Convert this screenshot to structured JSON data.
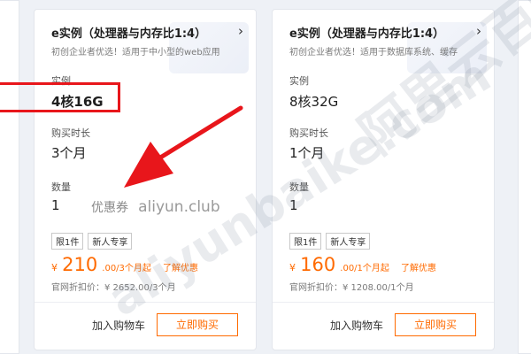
{
  "cards": [
    {
      "title": "e实例（处理器与内存比1:4）",
      "desc": "初创企业者优选！适用于中小型的web应用",
      "instance_label": "实例",
      "instance_value": "4核16G",
      "duration_label": "购买时长",
      "duration_value": "3个月",
      "qty_label": "数量",
      "qty_value": "1",
      "tags": [
        "限1件",
        "新人专享"
      ],
      "price_prefix": "¥",
      "price_main": "210",
      "price_suffix": ".00/3个月起",
      "promo_link": "了解优惠",
      "original_price": "官网折扣价：¥ 2652.00/3个月",
      "cart_label": "加入购物车",
      "buy_label": "立即购买"
    },
    {
      "title": "e实例（处理器与内存比1:4）",
      "desc": "初创企业者优选！适用于数据库系统、缓存",
      "instance_label": "实例",
      "instance_value": "8核32G",
      "duration_label": "购买时长",
      "duration_value": "1个月",
      "qty_label": "数量",
      "qty_value": "1",
      "tags": [
        "限1件",
        "新人专享"
      ],
      "price_prefix": "¥",
      "price_main": "160",
      "price_suffix": ".00/1个月起",
      "promo_link": "了解优惠",
      "original_price": "官网折扣价：¥ 1208.00/1个月",
      "cart_label": "加入购物车",
      "buy_label": "立即购买"
    }
  ],
  "overlay": {
    "coupon_label": "优惠券",
    "coupon_site": "aliyun.club",
    "watermark_1": "aliyunbaike.com",
    "watermark_2": "阿里云百科",
    "highlight_color": "#e8161b",
    "arrow_color": "#e8161b"
  },
  "colors": {
    "accent": "#ff6a00",
    "background": "#eef1f6"
  }
}
